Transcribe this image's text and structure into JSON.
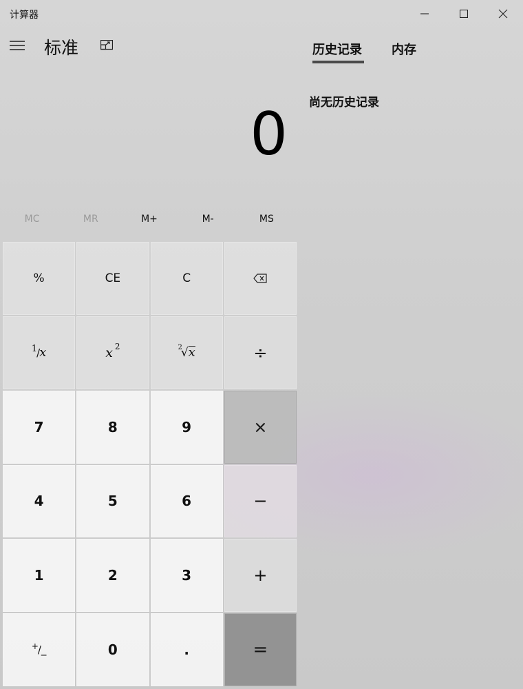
{
  "window": {
    "title": "计算器"
  },
  "header": {
    "mode": "标准"
  },
  "display": {
    "value": "0"
  },
  "memory": [
    "MC",
    "MR",
    "M+",
    "M-",
    "MS"
  ],
  "keys": {
    "percent": "%",
    "ce": "CE",
    "c": "C",
    "reciprocal_num": "1",
    "reciprocal_den": "x",
    "square_base": "x",
    "square_exp": "2",
    "sqrt_index": "2",
    "sqrt_radicand": "x",
    "divide": "÷",
    "multiply": "×",
    "minus": "−",
    "plus": "+",
    "equals": "=",
    "seven": "7",
    "eight": "8",
    "nine": "9",
    "four": "4",
    "five": "5",
    "six": "6",
    "one": "1",
    "two": "2",
    "three": "3",
    "negate_plus": "+",
    "negate_minus": "/_",
    "zero": "0",
    "decimal": "."
  },
  "history_panel": {
    "tabs": [
      "历史记录",
      "内存"
    ],
    "active_tab": "历史记录",
    "empty_text": "尚无历史记录"
  },
  "icons": {
    "menu": "hamburger-icon",
    "keep_on_top": "keep-on-top-icon",
    "backspace": "backspace-icon",
    "minimize": "minimize-icon",
    "maximize": "maximize-icon",
    "close": "close-icon"
  }
}
